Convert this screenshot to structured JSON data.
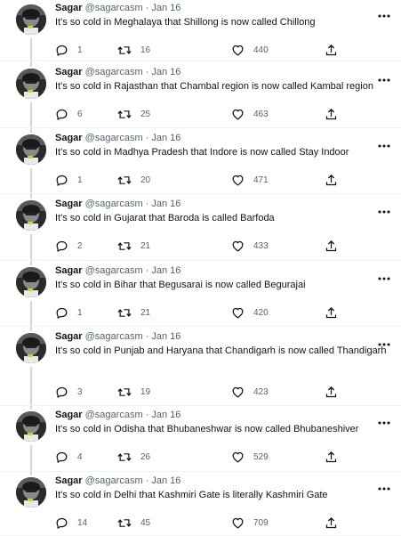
{
  "colors": {
    "text": "#0f1419",
    "secondary": "#536471",
    "thread_line": "#cfd9de",
    "divider": "#eff3f4"
  },
  "icons": {
    "reply": "speech-bubble-icon",
    "retweet": "retweet-arrows-icon",
    "like": "heart-outline-icon",
    "share": "upload-arrow-icon",
    "more": "three-dots-icon"
  },
  "tweets": [
    {
      "name": "Sagar",
      "handle": "@sagarcasm",
      "date": "· Jan 16",
      "text": "It's so cold in Meghalaya that Shillong is now called Chillong",
      "replies": "1",
      "retweets": "16",
      "likes": "440"
    },
    {
      "name": "Sagar",
      "handle": "@sagarcasm",
      "date": "· Jan 16",
      "text": "It's so cold in Rajasthan that Chambal region is now called Kambal region",
      "replies": "6",
      "retweets": "25",
      "likes": "463"
    },
    {
      "name": "Sagar",
      "handle": "@sagarcasm",
      "date": "· Jan 16",
      "text": "It's so cold in Madhya Pradesh that Indore is now called Stay Indoor",
      "replies": "1",
      "retweets": "20",
      "likes": "471"
    },
    {
      "name": "Sagar",
      "handle": "@sagarcasm",
      "date": "· Jan 16",
      "text": "It's so cold in Gujarat that Baroda is called Barfoda",
      "replies": "2",
      "retweets": "21",
      "likes": "433"
    },
    {
      "name": "Sagar",
      "handle": "@sagarcasm",
      "date": "· Jan 16",
      "text": "It's so cold in Bihar that Begusarai is now called Begurajai",
      "replies": "1",
      "retweets": "21",
      "likes": "420"
    },
    {
      "name": "Sagar",
      "handle": "@sagarcasm",
      "date": "· Jan 16",
      "text": "It's so cold in Punjab and Haryana that Chandigarh is now called Thandigarh",
      "replies": "3",
      "retweets": "19",
      "likes": "423"
    },
    {
      "name": "Sagar",
      "handle": "@sagarcasm",
      "date": "· Jan 16",
      "text": "It's so cold in Odisha that Bhubaneshwar is now called Bhubaneshiver",
      "replies": "4",
      "retweets": "26",
      "likes": "529"
    },
    {
      "name": "Sagar",
      "handle": "@sagarcasm",
      "date": "· Jan 16",
      "text": "It's so cold in Delhi that Kashmiri Gate is literally Kashmiri Gate",
      "replies": "14",
      "retweets": "45",
      "likes": "709"
    }
  ]
}
